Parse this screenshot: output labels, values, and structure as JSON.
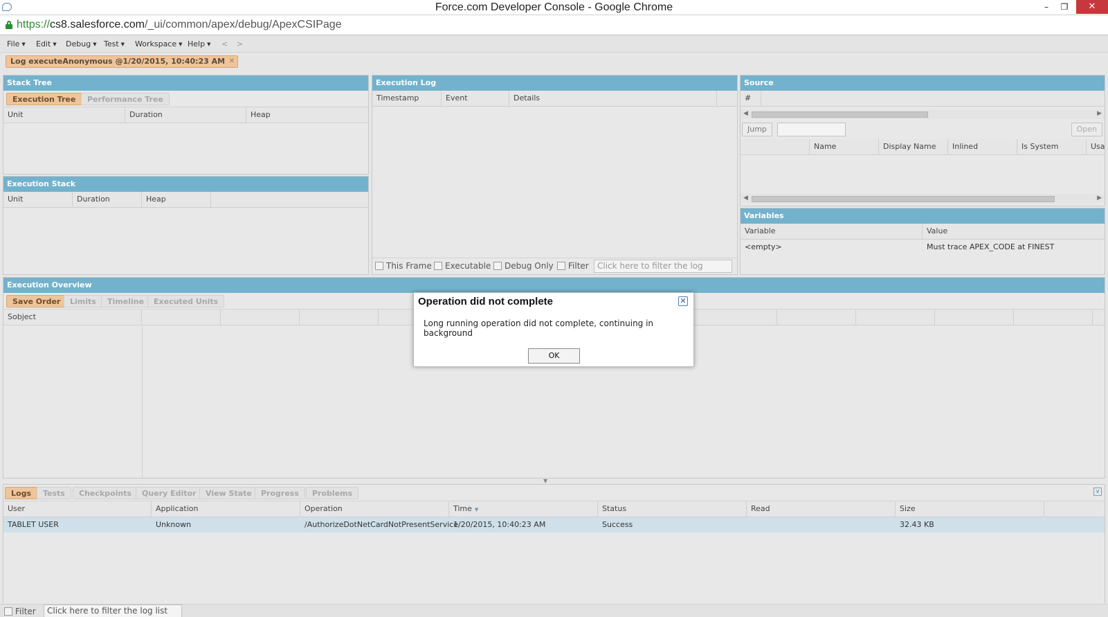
{
  "window": {
    "title": "Force.com Developer Console - Google Chrome"
  },
  "browser": {
    "url_scheme": "https://",
    "url_host": "cs8.salesforce.com",
    "url_path": "/_ui/common/apex/debug/ApexCSIPage"
  },
  "menu": {
    "items": [
      "File",
      "Edit",
      "Debug",
      "Test",
      "Workspace",
      "Help"
    ],
    "back": "<",
    "forward": ">"
  },
  "log_tab": {
    "label": "Log executeAnonymous @1/20/2015, 10:40:23 AM"
  },
  "stack_tree": {
    "title": "Stack Tree",
    "tabs": [
      "Execution Tree",
      "Performance Tree"
    ],
    "columns": [
      "Unit",
      "Duration",
      "Heap"
    ]
  },
  "execution_stack": {
    "title": "Execution Stack",
    "columns": [
      "Unit",
      "Duration",
      "Heap"
    ]
  },
  "execution_log": {
    "title": "Execution Log",
    "columns": [
      "Timestamp",
      "Event",
      "Details"
    ],
    "filters": [
      "This Frame",
      "Executable",
      "Debug Only",
      "Filter"
    ],
    "filter_placeholder": "Click here to filter the log"
  },
  "source": {
    "title": "Source",
    "hash_col": "#",
    "jump_label": "Jump",
    "open_label": "Open",
    "columns": [
      "Name",
      "Display Name",
      "Inlined",
      "Is System",
      "Usag"
    ]
  },
  "variables": {
    "title": "Variables",
    "columns": [
      "Variable",
      "Value"
    ],
    "row": {
      "variable": "<empty>",
      "value": "Must trace APEX_CODE at FINEST"
    }
  },
  "execution_overview": {
    "title": "Execution Overview",
    "tabs": [
      "Save Order",
      "Limits",
      "Timeline",
      "Executed Units"
    ],
    "subject_col": "Sobject"
  },
  "dialog": {
    "title": "Operation did not complete",
    "message": "Long running operation did not complete, continuing in background",
    "ok_label": "OK"
  },
  "bottom": {
    "tabs": [
      "Logs",
      "Tests",
      "Checkpoints",
      "Query Editor",
      "View State",
      "Progress",
      "Problems"
    ],
    "columns": [
      "User",
      "Application",
      "Operation",
      "Time",
      "Status",
      "Read",
      "Size"
    ],
    "rows": [
      {
        "user": "TABLET USER",
        "application": "Unknown",
        "operation": "/AuthorizeDotNetCardNotPresentService",
        "time": "1/20/2015, 10:40:23 AM",
        "status": "Success",
        "read": "",
        "size": "32.43 KB"
      }
    ],
    "filter_label": "Filter",
    "filter_placeholder": "Click here to filter the log list"
  },
  "colors": {
    "panel_header": "#73b2cc",
    "active_tab": "#efc49a",
    "close_button": "#c7383c",
    "secure_green": "#2e8b30"
  }
}
